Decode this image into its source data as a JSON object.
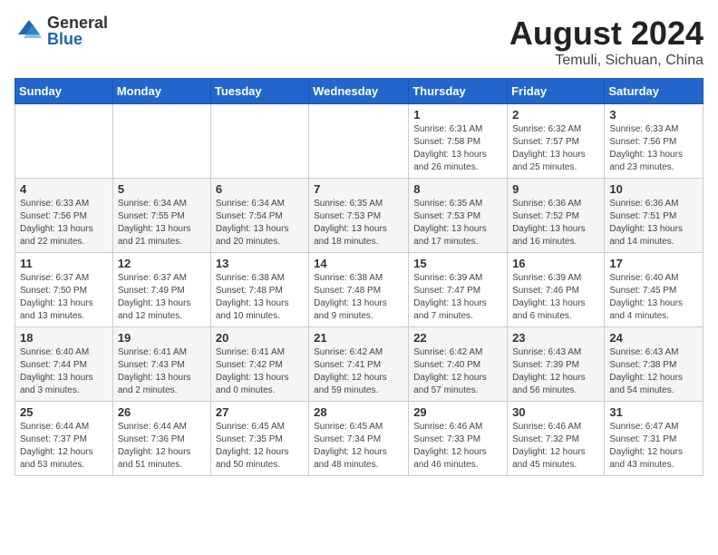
{
  "logo": {
    "general": "General",
    "blue": "Blue"
  },
  "title": "August 2024",
  "location": "Temuli, Sichuan, China",
  "weekdays": [
    "Sunday",
    "Monday",
    "Tuesday",
    "Wednesday",
    "Thursday",
    "Friday",
    "Saturday"
  ],
  "weeks": [
    [
      {
        "day": "",
        "info": ""
      },
      {
        "day": "",
        "info": ""
      },
      {
        "day": "",
        "info": ""
      },
      {
        "day": "",
        "info": ""
      },
      {
        "day": "1",
        "info": "Sunrise: 6:31 AM\nSunset: 7:58 PM\nDaylight: 13 hours and 26 minutes."
      },
      {
        "day": "2",
        "info": "Sunrise: 6:32 AM\nSunset: 7:57 PM\nDaylight: 13 hours and 25 minutes."
      },
      {
        "day": "3",
        "info": "Sunrise: 6:33 AM\nSunset: 7:56 PM\nDaylight: 13 hours and 23 minutes."
      }
    ],
    [
      {
        "day": "4",
        "info": "Sunrise: 6:33 AM\nSunset: 7:56 PM\nDaylight: 13 hours and 22 minutes."
      },
      {
        "day": "5",
        "info": "Sunrise: 6:34 AM\nSunset: 7:55 PM\nDaylight: 13 hours and 21 minutes."
      },
      {
        "day": "6",
        "info": "Sunrise: 6:34 AM\nSunset: 7:54 PM\nDaylight: 13 hours and 20 minutes."
      },
      {
        "day": "7",
        "info": "Sunrise: 6:35 AM\nSunset: 7:53 PM\nDaylight: 13 hours and 18 minutes."
      },
      {
        "day": "8",
        "info": "Sunrise: 6:35 AM\nSunset: 7:53 PM\nDaylight: 13 hours and 17 minutes."
      },
      {
        "day": "9",
        "info": "Sunrise: 6:36 AM\nSunset: 7:52 PM\nDaylight: 13 hours and 16 minutes."
      },
      {
        "day": "10",
        "info": "Sunrise: 6:36 AM\nSunset: 7:51 PM\nDaylight: 13 hours and 14 minutes."
      }
    ],
    [
      {
        "day": "11",
        "info": "Sunrise: 6:37 AM\nSunset: 7:50 PM\nDaylight: 13 hours and 13 minutes."
      },
      {
        "day": "12",
        "info": "Sunrise: 6:37 AM\nSunset: 7:49 PM\nDaylight: 13 hours and 12 minutes."
      },
      {
        "day": "13",
        "info": "Sunrise: 6:38 AM\nSunset: 7:48 PM\nDaylight: 13 hours and 10 minutes."
      },
      {
        "day": "14",
        "info": "Sunrise: 6:38 AM\nSunset: 7:48 PM\nDaylight: 13 hours and 9 minutes."
      },
      {
        "day": "15",
        "info": "Sunrise: 6:39 AM\nSunset: 7:47 PM\nDaylight: 13 hours and 7 minutes."
      },
      {
        "day": "16",
        "info": "Sunrise: 6:39 AM\nSunset: 7:46 PM\nDaylight: 13 hours and 6 minutes."
      },
      {
        "day": "17",
        "info": "Sunrise: 6:40 AM\nSunset: 7:45 PM\nDaylight: 13 hours and 4 minutes."
      }
    ],
    [
      {
        "day": "18",
        "info": "Sunrise: 6:40 AM\nSunset: 7:44 PM\nDaylight: 13 hours and 3 minutes."
      },
      {
        "day": "19",
        "info": "Sunrise: 6:41 AM\nSunset: 7:43 PM\nDaylight: 13 hours and 2 minutes."
      },
      {
        "day": "20",
        "info": "Sunrise: 6:41 AM\nSunset: 7:42 PM\nDaylight: 13 hours and 0 minutes."
      },
      {
        "day": "21",
        "info": "Sunrise: 6:42 AM\nSunset: 7:41 PM\nDaylight: 12 hours and 59 minutes."
      },
      {
        "day": "22",
        "info": "Sunrise: 6:42 AM\nSunset: 7:40 PM\nDaylight: 12 hours and 57 minutes."
      },
      {
        "day": "23",
        "info": "Sunrise: 6:43 AM\nSunset: 7:39 PM\nDaylight: 12 hours and 56 minutes."
      },
      {
        "day": "24",
        "info": "Sunrise: 6:43 AM\nSunset: 7:38 PM\nDaylight: 12 hours and 54 minutes."
      }
    ],
    [
      {
        "day": "25",
        "info": "Sunrise: 6:44 AM\nSunset: 7:37 PM\nDaylight: 12 hours and 53 minutes."
      },
      {
        "day": "26",
        "info": "Sunrise: 6:44 AM\nSunset: 7:36 PM\nDaylight: 12 hours and 51 minutes."
      },
      {
        "day": "27",
        "info": "Sunrise: 6:45 AM\nSunset: 7:35 PM\nDaylight: 12 hours and 50 minutes."
      },
      {
        "day": "28",
        "info": "Sunrise: 6:45 AM\nSunset: 7:34 PM\nDaylight: 12 hours and 48 minutes."
      },
      {
        "day": "29",
        "info": "Sunrise: 6:46 AM\nSunset: 7:33 PM\nDaylight: 12 hours and 46 minutes."
      },
      {
        "day": "30",
        "info": "Sunrise: 6:46 AM\nSunset: 7:32 PM\nDaylight: 12 hours and 45 minutes."
      },
      {
        "day": "31",
        "info": "Sunrise: 6:47 AM\nSunset: 7:31 PM\nDaylight: 12 hours and 43 minutes."
      }
    ]
  ]
}
